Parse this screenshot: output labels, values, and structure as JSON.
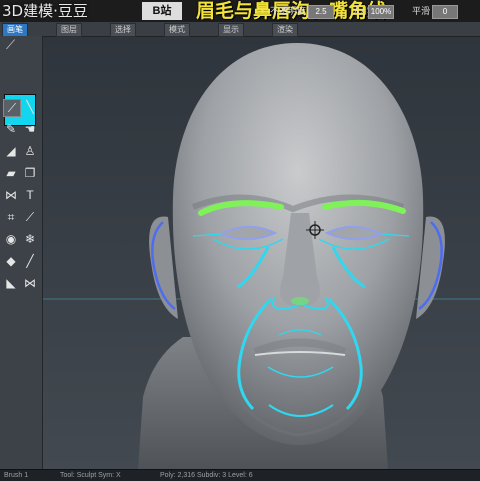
{
  "banner": {
    "logo_text": "3D建模·豆豆",
    "logo_badge": "B站",
    "headline": "眉毛与鼻唇沟、嘴角线"
  },
  "toolbar_top": {
    "field_1_label": "不透明度",
    "field_1_value": "2.5",
    "field_2_label": "大小",
    "field_2_value": "100%",
    "field_3_label": "平滑",
    "field_3_value": "0"
  },
  "menu": {
    "items": [
      "画笔",
      "图层",
      "选择",
      "模式",
      "显示",
      "渲染"
    ]
  },
  "tools": {
    "active_color": "#12d5f0",
    "icons": [
      "brush-icon",
      "line-icon",
      "pencil-icon",
      "smudge-icon",
      "bucket-icon",
      "stamp-icon",
      "eraser-icon",
      "copy-icon",
      "mirror-icon",
      "text-icon",
      "crop-icon",
      "knife-icon",
      "eye-icon",
      "snowflake-icon",
      "ruler-icon",
      "move-icon",
      "fill-icon",
      "butterfly-icon"
    ]
  },
  "status": {
    "item_1": "Brush 1",
    "item_2": "Tool: Sculpt  Sym: X",
    "item_3": "Poly: 2,316  Subdiv: 3  Level: 6"
  },
  "colors": {
    "accent": "#2c78c4",
    "eyebrow": "#7ff25a",
    "curve_cyan": "#2fd8f0",
    "curve_blue": "#4d6cf0"
  }
}
